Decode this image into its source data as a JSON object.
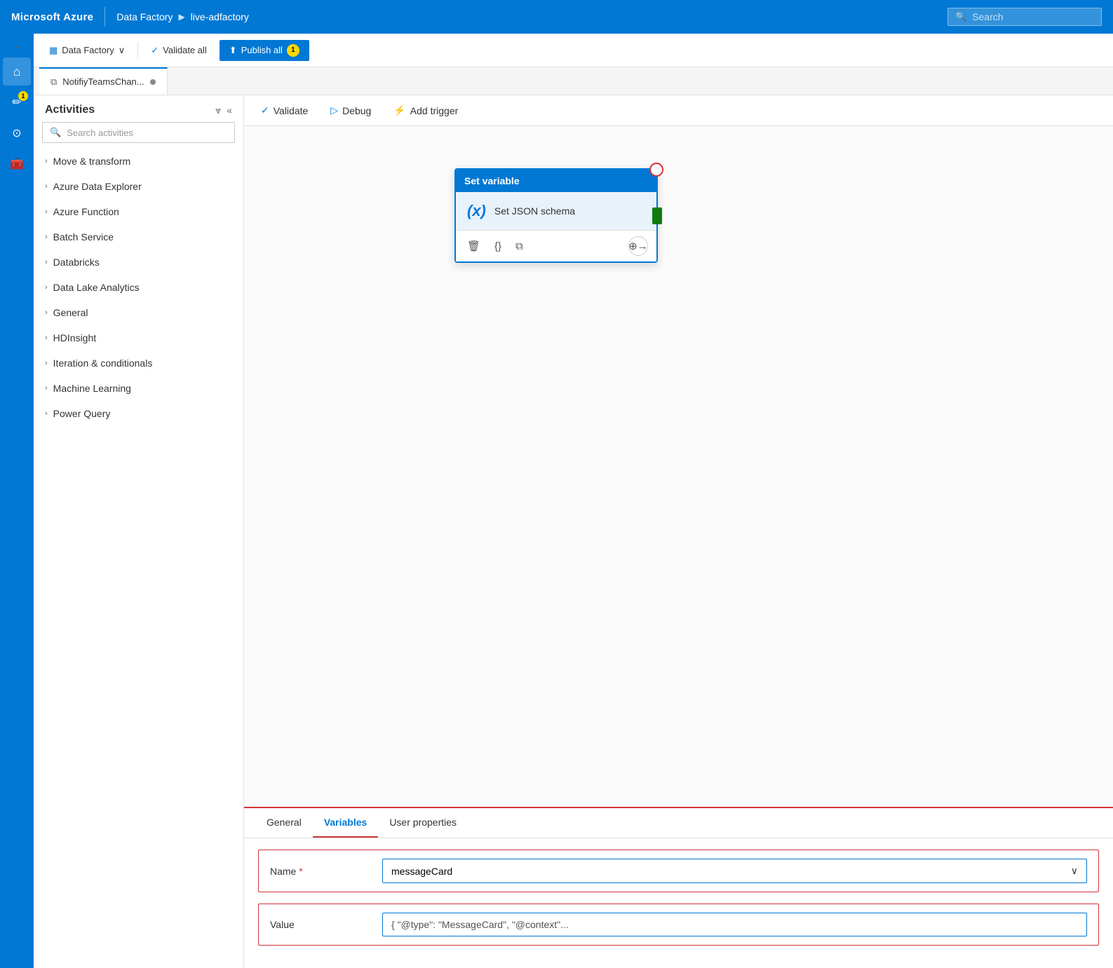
{
  "topbar": {
    "brand": "Microsoft Azure",
    "nav_item1": "Data Factory",
    "nav_arrow": "▶",
    "nav_item2": "live-adfactory",
    "search_placeholder": "Search"
  },
  "toolbar": {
    "data_factory_label": "Data Factory",
    "validate_label": "Validate all",
    "publish_label": "Publish all",
    "publish_badge": "1"
  },
  "tab_bar": {
    "tab1_label": "NotifiyTeamsChan..."
  },
  "activities_panel": {
    "title": "Activities",
    "search_placeholder": "Search activities",
    "categories": [
      "Move & transform",
      "Azure Data Explorer",
      "Azure Function",
      "Batch Service",
      "Databricks",
      "Data Lake Analytics",
      "General",
      "HDInsight",
      "Iteration & conditionals",
      "Machine Learning",
      "Power Query"
    ]
  },
  "canvas_toolbar": {
    "validate_label": "Validate",
    "debug_label": "Debug",
    "add_trigger_label": "Add trigger"
  },
  "activity_card": {
    "header": "Set variable",
    "icon": "(x)",
    "label": "Set JSON schema"
  },
  "bottom_panel": {
    "tab_general": "General",
    "tab_variables": "Variables",
    "tab_user_props": "User properties",
    "name_label": "Name",
    "name_required": "*",
    "name_value": "messageCard",
    "value_label": "Value",
    "value_value": "{ \"@type\": \"MessageCard\", \"@context\"..."
  },
  "icons": {
    "expand": "»",
    "collapse_left": "«",
    "chevron_down": "∨",
    "chevron_right": "›",
    "search": "🔍",
    "home": "⌂",
    "pencil": "✏",
    "gear": "⚙",
    "briefcase": "💼",
    "validate_check": "✓",
    "debug_play": "▷",
    "trigger_lightning": "⚡",
    "delete": "🗑",
    "braces": "{}",
    "copy": "⧉",
    "connect": "⊕→"
  }
}
